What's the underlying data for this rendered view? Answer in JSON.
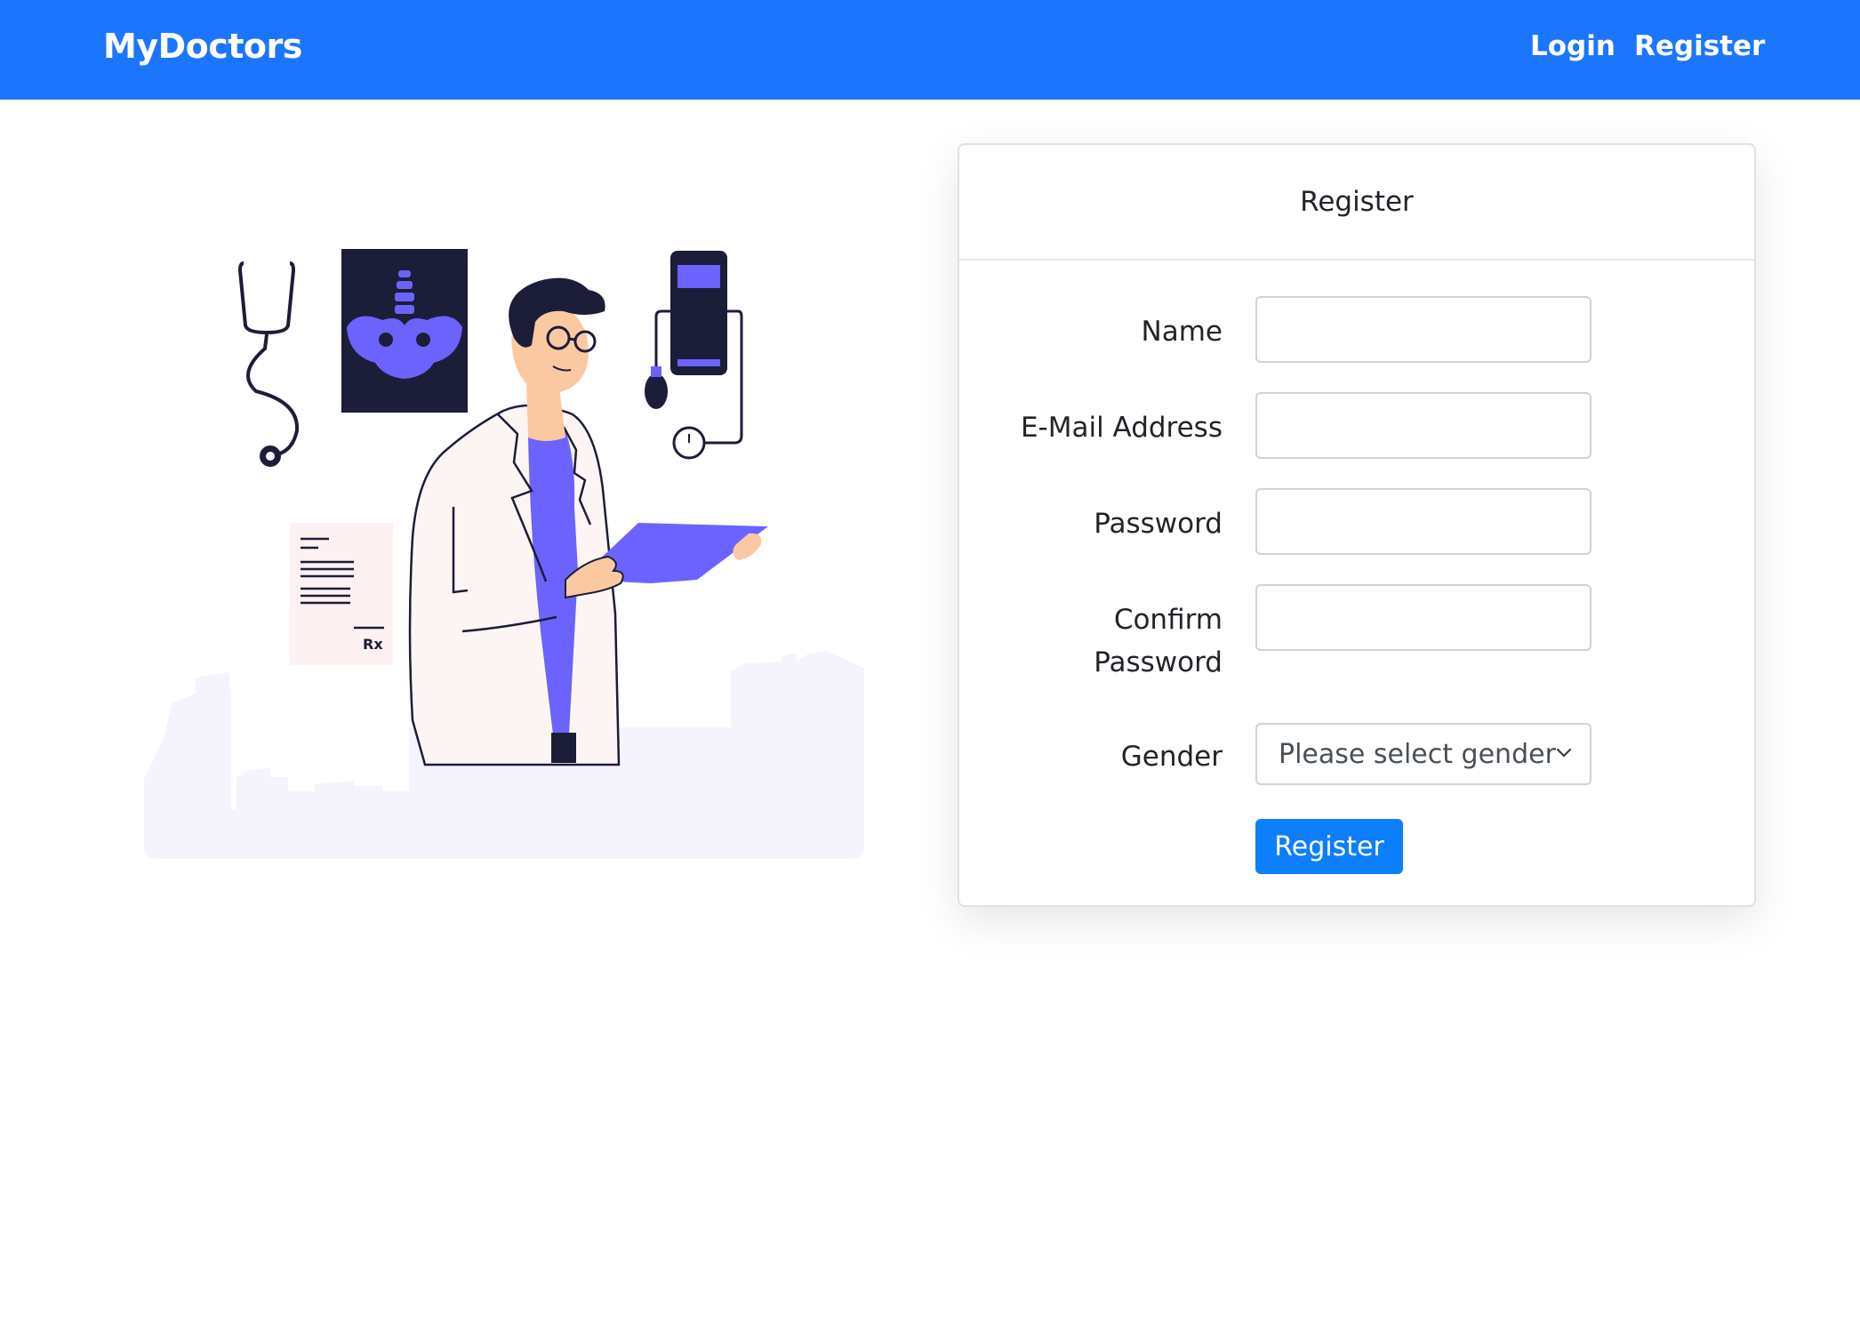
{
  "navbar": {
    "brand": "MyDoctors",
    "links": {
      "login": "Login",
      "register": "Register"
    },
    "background_color": "#1c76fd"
  },
  "illustration": {
    "rx_label": "Rx",
    "accent_color": "#6c63ff"
  },
  "form": {
    "title": "Register",
    "fields": {
      "name": {
        "label": "Name",
        "value": ""
      },
      "email": {
        "label": "E-Mail Address",
        "value": ""
      },
      "password": {
        "label": "Password",
        "value": ""
      },
      "confirm_password": {
        "label_line1": "Confirm",
        "label_line2": "Password",
        "value": ""
      }
    },
    "gender": {
      "label": "Gender",
      "selected": "Please select gender"
    },
    "submit_label": "Register",
    "button_color": "#0d7efd"
  }
}
